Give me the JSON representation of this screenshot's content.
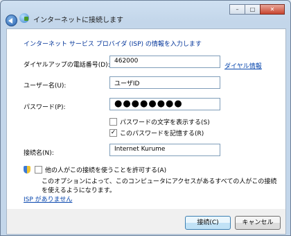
{
  "window": {
    "title": "インターネットに接続します",
    "buttons": {
      "minimize": "–",
      "maximize": "□",
      "close": "✕"
    }
  },
  "form": {
    "heading": "インターネット サービス プロバイダ (ISP) の情報を入力します",
    "phone_label": "ダイヤルアップの電話番号(D):",
    "phone_value": "462000",
    "dial_info_link": "ダイヤル情報",
    "user_label": "ユーザー名(U):",
    "user_value": "ユーザID",
    "password_label": "パスワード(P):",
    "password_value": "●●●●●●●●",
    "show_chars_label": "パスワードの文字を表示する(S)",
    "show_chars_checked": false,
    "remember_label": "このパスワードを記憶する(R)",
    "remember_checked": true,
    "conn_label": "接続名(N):",
    "conn_value": "Internet Kurume",
    "allow_others_label": "他の人がこの接続を使うことを許可する(A)",
    "allow_others_checked": false,
    "allow_others_note": "このオプションによって、このコンピュータにアクセスがあるすべての人がこの接続を使えるようになります。",
    "no_isp_link": "ISP がありません"
  },
  "footer": {
    "connect_label": "接続(C)",
    "cancel_label": "キャンセル"
  }
}
